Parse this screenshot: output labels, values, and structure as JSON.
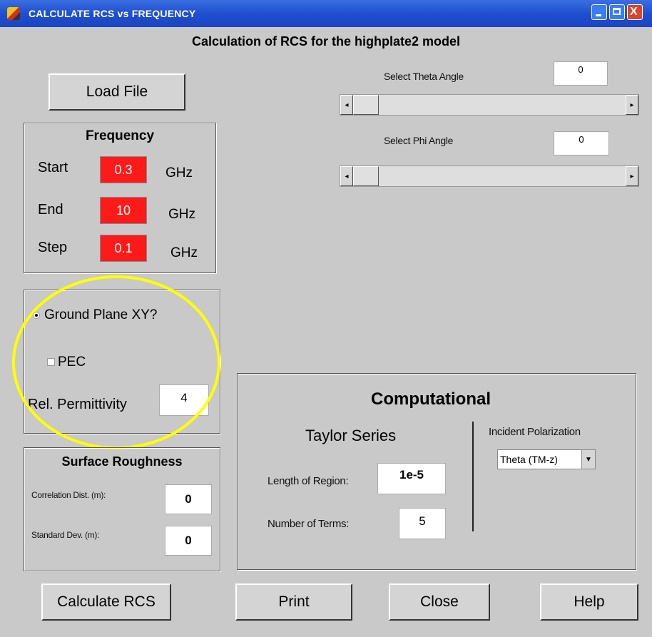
{
  "window": {
    "title": "CALCULATE RCS vs FREQUENCY"
  },
  "header": {
    "title": "Calculation of RCS for the highplate2 model"
  },
  "load_button": "Load File",
  "frequency": {
    "title": "Frequency",
    "start_label": "Start",
    "start_value": "0.3",
    "end_label": "End",
    "end_value": "10",
    "step_label": "Step",
    "step_value": "0.1",
    "unit": "GHz"
  },
  "theta": {
    "label": "Select Theta Angle",
    "value": "0"
  },
  "phi": {
    "label": "Select Phi Angle",
    "value": "0"
  },
  "ground": {
    "ground_plane_label": "Ground Plane XY?",
    "pec_label": "PEC",
    "permittivity_label": "Rel. Permittivity",
    "permittivity_value": "4"
  },
  "roughness": {
    "title": "Surface Roughness",
    "corr_label": "Correlation Dist. (m):",
    "corr_value": "0",
    "std_label": "Standard Dev. (m):",
    "std_value": "0"
  },
  "computational": {
    "title": "Computational",
    "taylor_title": "Taylor Series",
    "length_label": "Length of Region:",
    "length_value": "1e-5",
    "terms_label": "Number of Terms:",
    "terms_value": "5",
    "polarization_label": "Incident Polarization",
    "polarization_value": "Theta (TM-z)"
  },
  "buttons": {
    "calculate": "Calculate RCS",
    "print": "Print",
    "close": "Close",
    "help": "Help"
  },
  "colors": {
    "highlight_circle": "#ffff00",
    "field_red": "#ff1a1a",
    "titlebar": "#1f4fd0"
  }
}
